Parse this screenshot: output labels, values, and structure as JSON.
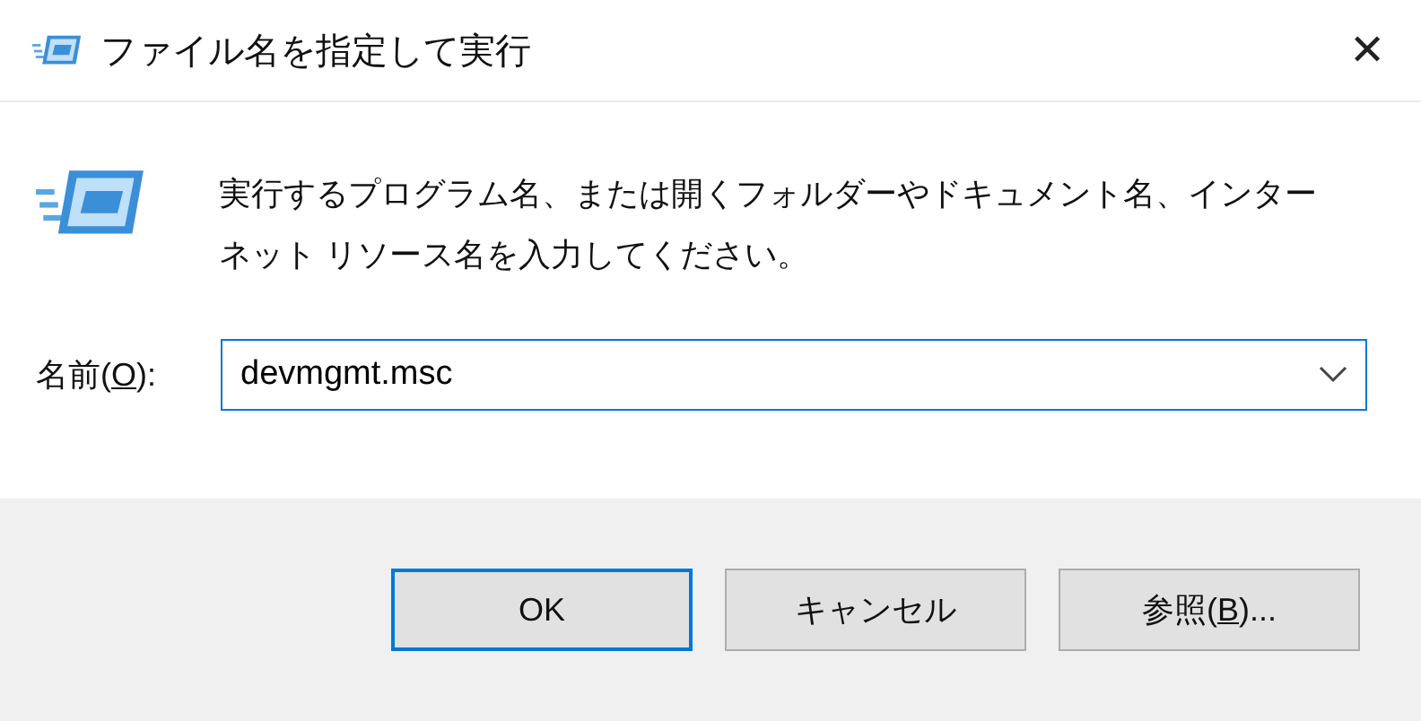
{
  "window": {
    "title": "ファイル名を指定して実行",
    "close": "✕"
  },
  "description": "実行するプログラム名、または開くフォルダーやドキュメント名、インターネット リソース名を入力してください。",
  "name_field": {
    "label": {
      "before": "名前(",
      "key": "O",
      "after": "):"
    },
    "value": "devmgmt.msc",
    "focused": true
  },
  "buttons": [
    {
      "label": {
        "before": "OK"
      },
      "default": true
    },
    {
      "label": {
        "before": "キャンセル"
      },
      "default": false
    },
    {
      "label": {
        "before": "参照(",
        "key": "B",
        "after": ")..."
      },
      "default": false
    }
  ]
}
